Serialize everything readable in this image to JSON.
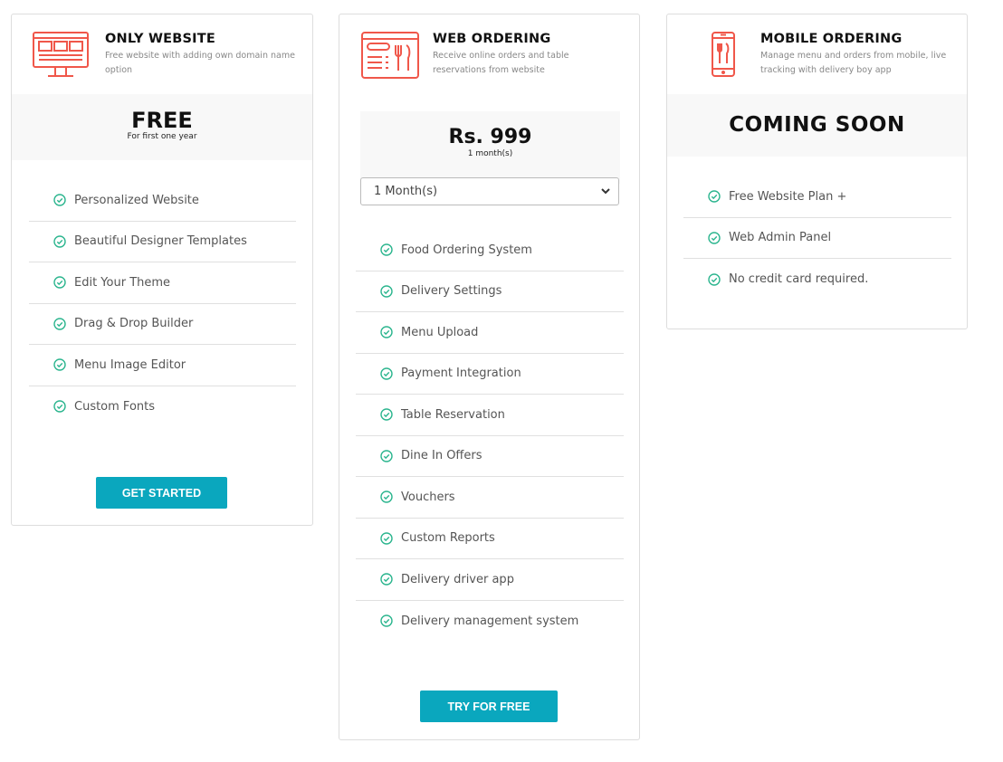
{
  "colors": {
    "accent": "#0aa7be",
    "icon": "#f0574a",
    "check": "#2bb58e"
  },
  "plans": [
    {
      "title": "ONLY WEBSITE",
      "description": "Free website with adding own domain name option",
      "icon": "monitor-icon",
      "price": "FREE",
      "price_note": "For first one year",
      "features": [
        "Personalized Website",
        "Beautiful Designer Templates",
        "Edit Your Theme",
        "Drag & Drop Builder",
        "Menu Image Editor",
        "Custom Fonts"
      ],
      "button": "GET STARTED"
    },
    {
      "title": "WEB ORDERING",
      "description": "Receive online orders and table reservations from website",
      "icon": "web-ordering-icon",
      "price": "Rs. 999",
      "price_note": "1 month(s)",
      "duration_select": "1 Month(s)",
      "features": [
        "Food Ordering System",
        "Delivery Settings",
        "Menu Upload",
        "Payment Integration",
        "Table Reservation",
        "Dine In Offers",
        "Vouchers",
        "Custom Reports",
        "Delivery driver app",
        "Delivery management system"
      ],
      "button": "TRY FOR FREE"
    },
    {
      "title": "MOBILE ORDERING",
      "description": "Manage menu and orders from mobile, live tracking with delivery boy app",
      "icon": "mobile-ordering-icon",
      "price": "COMING SOON",
      "features": [
        "Free Website Plan +",
        "Web Admin Panel",
        "No credit card required."
      ]
    }
  ]
}
